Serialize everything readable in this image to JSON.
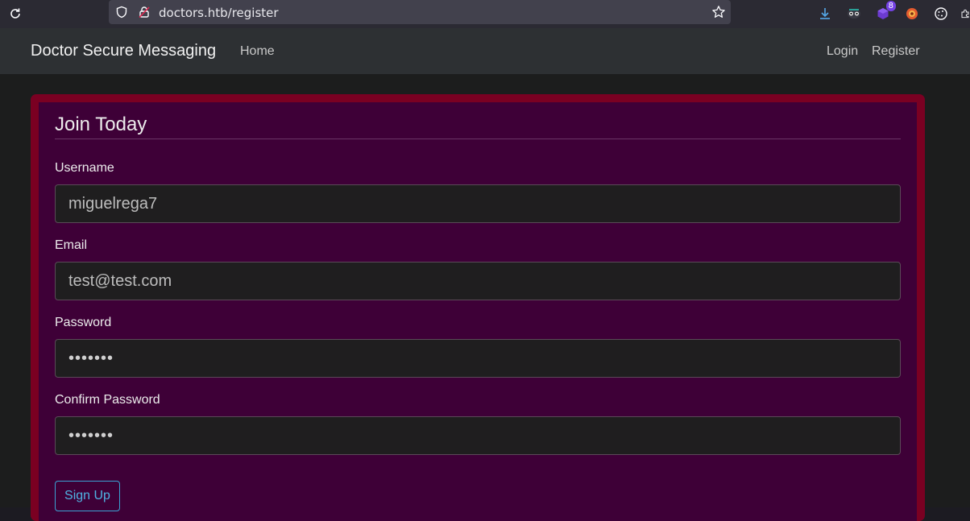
{
  "browser": {
    "url_text": "doctors.htb/register",
    "badge_count": "8"
  },
  "nav": {
    "brand": "Doctor Secure Messaging",
    "home": "Home",
    "login": "Login",
    "register": "Register"
  },
  "form": {
    "legend": "Join Today",
    "username_label": "Username",
    "username_value": "miguelrega7",
    "email_label": "Email",
    "email_value": "test@test.com",
    "password_label": "Password",
    "password_value": "•••••••",
    "confirm_label": "Confirm Password",
    "confirm_value": "•••••••",
    "submit_label": "Sign Up"
  },
  "colors": {
    "card_border": "#7a0022",
    "card_bg": "#3e0037",
    "button_accent": "#3aa3d4"
  }
}
